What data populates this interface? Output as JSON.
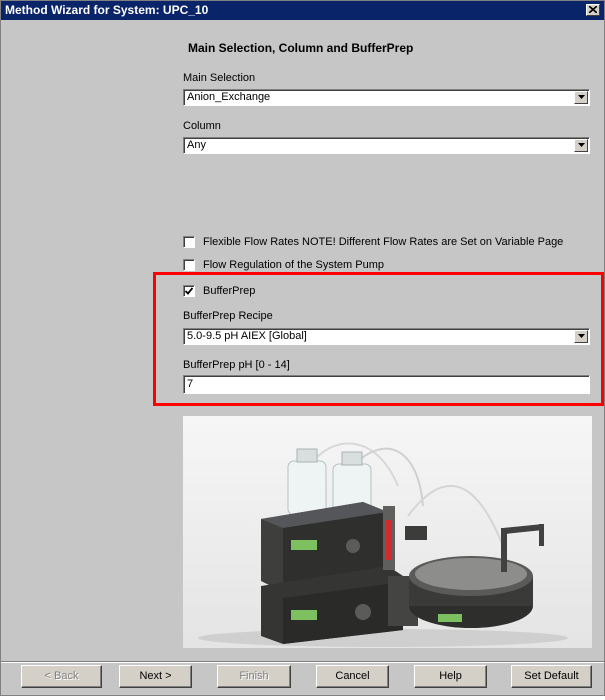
{
  "window": {
    "title": "Method Wizard for System: UPC_10",
    "close_icon": "close-icon"
  },
  "page": {
    "heading": "Main Selection,  Column and BufferPrep"
  },
  "main_selection": {
    "label": "Main Selection",
    "value": "Anion_Exchange"
  },
  "column": {
    "label": "Column",
    "value": "Any"
  },
  "options": {
    "flexible_flow": {
      "label": "Flexible Flow Rates   NOTE! Different Flow Rates are Set on Variable Page",
      "checked": false
    },
    "flow_regulation": {
      "label": "Flow Regulation of the System Pump",
      "checked": false
    },
    "bufferprep": {
      "label": "BufferPrep",
      "checked": true
    }
  },
  "bufferprep_recipe": {
    "label": "BufferPrep Recipe",
    "value": "5.0-9.5 pH AIEX [Global]"
  },
  "bufferprep_ph": {
    "label": "BufferPrep pH [0 - 14]",
    "value": "7"
  },
  "highlight_color": "#ff0000",
  "photo": {
    "subject": "chromatography-system-photo"
  },
  "buttons": {
    "back": "< Back",
    "next": "Next >",
    "finish": "Finish",
    "cancel": "Cancel",
    "help": "Help",
    "set_default": "Set Default"
  }
}
